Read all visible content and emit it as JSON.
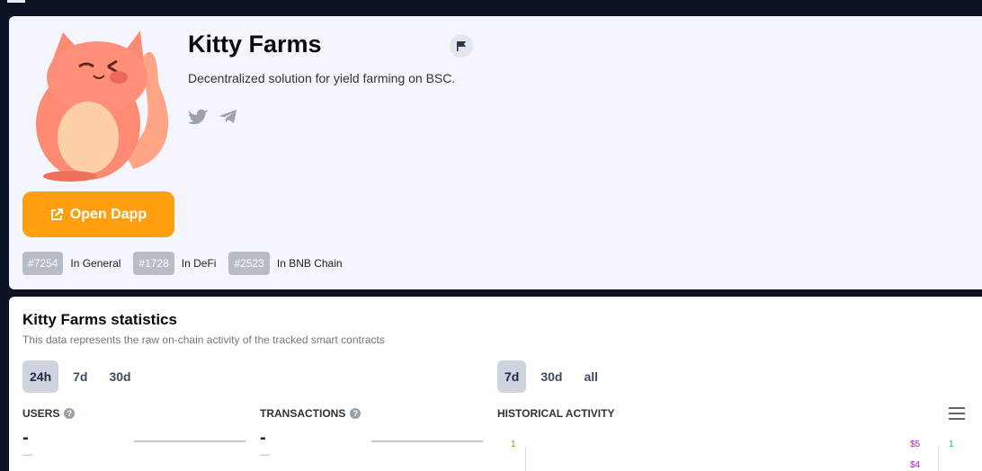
{
  "app": {
    "name": "Kitty Farms",
    "description": "Decentralized solution for yield farming on BSC.",
    "open_button": "Open Dapp",
    "social_icons": [
      "twitter-icon",
      "telegram-icon"
    ],
    "report_icon": "flag-icon",
    "accent_color": "#ff9f0f"
  },
  "ranks": [
    {
      "rank": "#7254",
      "label": "In General"
    },
    {
      "rank": "#1728",
      "label": "In DeFi"
    },
    {
      "rank": "#2523",
      "label": "In BNB Chain"
    }
  ],
  "stats": {
    "title": "Kitty Farms statistics",
    "subtitle": "This data represents the raw on-chain activity of the tracked smart contracts",
    "period_tabs": [
      {
        "label": "24h",
        "active": true
      },
      {
        "label": "7d",
        "active": false
      },
      {
        "label": "30d",
        "active": false
      }
    ],
    "history_tabs": [
      {
        "label": "7d",
        "active": true
      },
      {
        "label": "30d",
        "active": false
      },
      {
        "label": "all",
        "active": false
      }
    ],
    "users": {
      "label": "USERS",
      "value": "-",
      "sub": "—"
    },
    "transactions": {
      "label": "TRANSACTIONS",
      "value": "-",
      "sub": "—"
    },
    "historical": {
      "label": "HISTORICAL ACTIVITY",
      "left_axis_top": "1",
      "right_axis_top": "1",
      "price_ticks": [
        "$5",
        "$4"
      ]
    }
  }
}
